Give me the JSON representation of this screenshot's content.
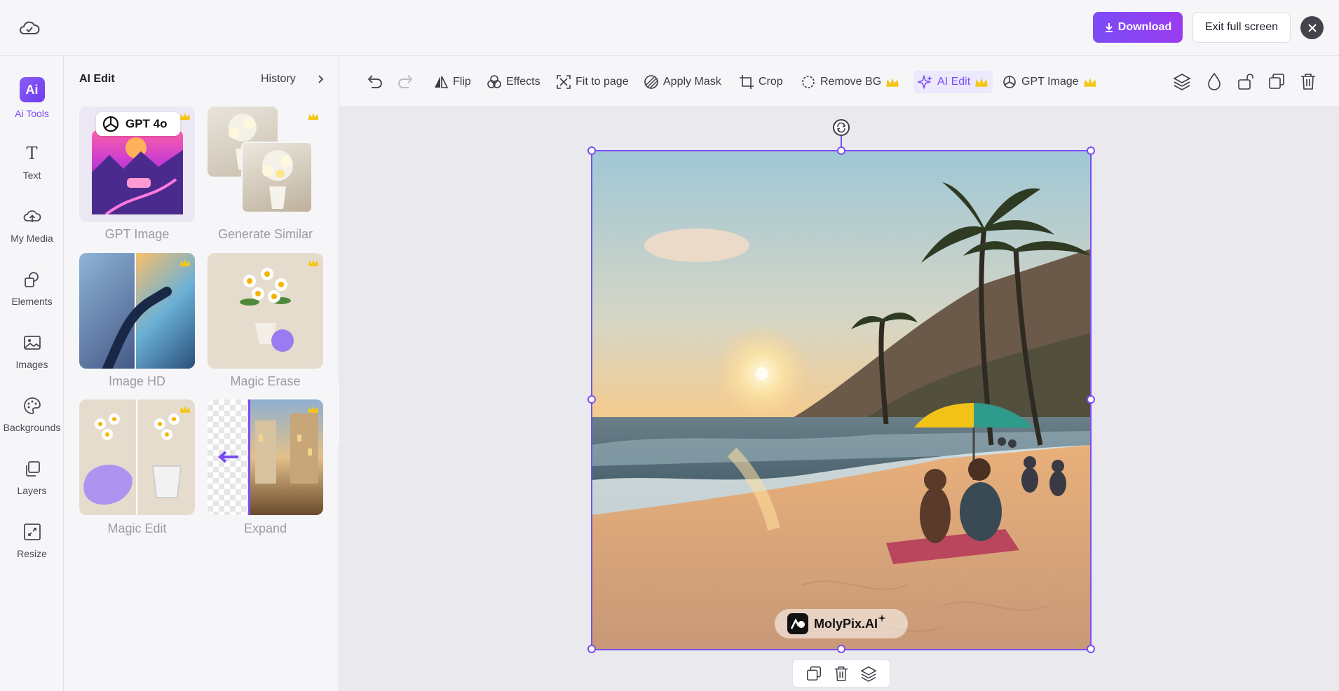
{
  "topbar": {
    "download_label": "Download",
    "exit_label": "Exit full screen"
  },
  "rail": {
    "items": [
      {
        "label": "Ai Tools",
        "icon": "ai-tools-icon",
        "badge": "Ai"
      },
      {
        "label": "Text",
        "icon": "text-icon"
      },
      {
        "label": "My Media",
        "icon": "upload-cloud-icon"
      },
      {
        "label": "Elements",
        "icon": "shapes-icon"
      },
      {
        "label": "Images",
        "icon": "image-icon"
      },
      {
        "label": "Backgrounds",
        "icon": "palette-icon"
      },
      {
        "label": "Layers",
        "icon": "layers-icon"
      },
      {
        "label": "Resize",
        "icon": "resize-icon"
      }
    ]
  },
  "panel": {
    "title": "AI Edit",
    "history_label": "History",
    "gpt_badge": "GPT 4o",
    "tools": [
      {
        "label": "GPT Image",
        "premium": true
      },
      {
        "label": "Generate Similar",
        "premium": true
      },
      {
        "label": "Image HD",
        "premium": true
      },
      {
        "label": "Magic Erase",
        "premium": true
      },
      {
        "label": "Magic Edit",
        "premium": true
      },
      {
        "label": "Expand",
        "premium": true
      }
    ]
  },
  "toolbar": {
    "flip": "Flip",
    "effects": "Effects",
    "fit": "Fit to page",
    "mask": "Apply Mask",
    "crop": "Crop",
    "remove_bg": "Remove BG",
    "ai_edit": "AI Edit",
    "gpt_image": "GPT Image"
  },
  "canvas": {
    "watermark": "MolyPix.AI"
  },
  "colors": {
    "accent": "#7b4cf6",
    "crown": "#f5c518"
  }
}
